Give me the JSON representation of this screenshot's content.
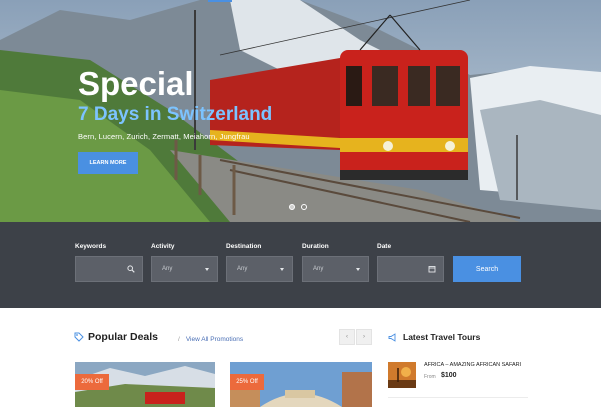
{
  "hero": {
    "title": "Special",
    "subtitle": "7 Days in Switzerland",
    "places": "Bern, Lucern, Zurich, Zermatt, Meiahorn, Jungfrau",
    "cta_label": "LEARN MORE"
  },
  "search": {
    "fields": [
      {
        "label": "Keywords",
        "value": ""
      },
      {
        "label": "Activity",
        "value": "Any"
      },
      {
        "label": "Destination",
        "value": "Any"
      },
      {
        "label": "Duration",
        "value": "Any"
      },
      {
        "label": "Date",
        "value": ""
      }
    ],
    "button_label": "Search"
  },
  "deals": {
    "title": "Popular Deals",
    "view_all": "View All Promotions",
    "prev": "‹",
    "next": "›",
    "cards": [
      {
        "badge": "20% Off"
      },
      {
        "badge": "25% Off"
      }
    ]
  },
  "latest": {
    "title": "Latest Travel Tours",
    "tours": [
      {
        "name": "AFRICA – AMAZING AFRICAN SAFARI",
        "from_label": "From",
        "price": "$100"
      }
    ]
  },
  "colors": {
    "accent": "#4a90e2",
    "badge": "#ec6a3c",
    "search_bg": "#3d4148"
  }
}
